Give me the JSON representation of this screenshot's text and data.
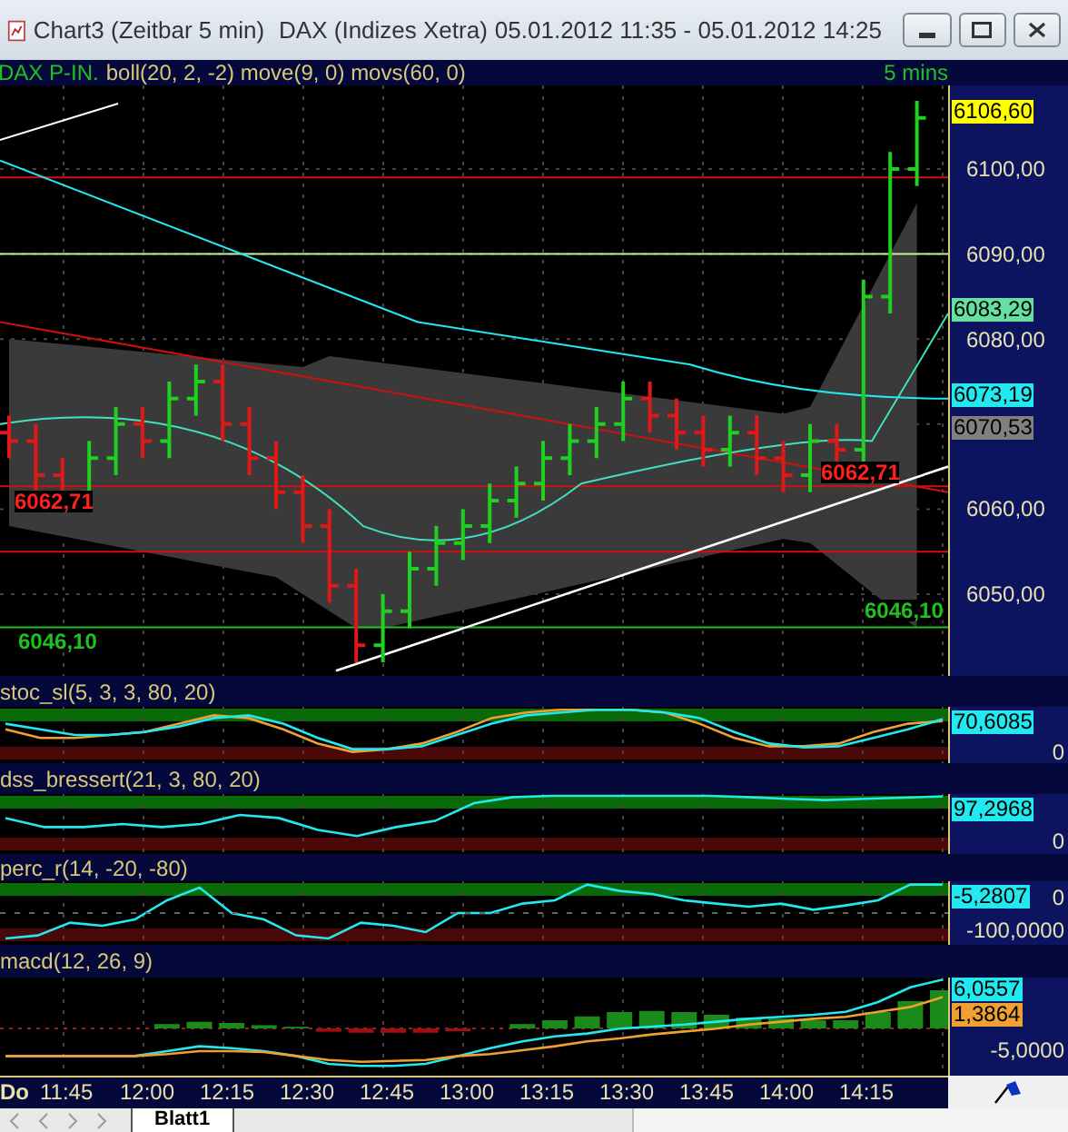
{
  "window": {
    "title": "Chart3 (Zeitbar 5 min)",
    "instrument": "DAX (Indizes Xetra)",
    "range": "05.01.2012 11:35 - 05.01.2012 14:25"
  },
  "header": {
    "symbol": "DAX P-IN.",
    "studies": "boll(20, 2, -2) move(9, 0) movs(60, 0)",
    "interval": "5 mins"
  },
  "price_axis": [
    "6100,00",
    "6090,00",
    "6080,00",
    "6060,00",
    "6050,00"
  ],
  "price_tags": [
    {
      "text": "6106,60",
      "color": "#ffff00"
    },
    {
      "text": "6083,29",
      "color": "#66e0a0"
    },
    {
      "text": "6073,19",
      "color": "#22e8f0"
    },
    {
      "text": "6070,53",
      "color": "#808080"
    }
  ],
  "chart_labels": [
    {
      "text": "6062,71",
      "kind": "resistance"
    },
    {
      "text": "6062,71",
      "kind": "resistance"
    },
    {
      "text": "6046,10",
      "kind": "support"
    },
    {
      "text": "6046,10",
      "kind": "support"
    }
  ],
  "indicators": [
    {
      "kind": "stoch",
      "title": "stoc_sl(5, 3, 3, 80, 20)",
      "tags": [
        {
          "text": "70,6085",
          "color": "#22e8f0"
        }
      ],
      "axis": [
        "0"
      ]
    },
    {
      "kind": "dss",
      "title": "dss_bressert(21, 3, 80, 20)",
      "tags": [
        {
          "text": "97,2968",
          "color": "#22e8f0"
        }
      ],
      "axis": [
        "0"
      ]
    },
    {
      "kind": "percr",
      "title": "perc_r(14, -20, -80)",
      "tags": [
        {
          "text": "-5,2807",
          "color": "#22e8f0"
        }
      ],
      "axis": [
        "0",
        "-100,0000"
      ]
    },
    {
      "kind": "macd",
      "title": "macd(12, 26, 9)",
      "tags": [
        {
          "text": "6,0557",
          "color": "#22e8f0"
        },
        {
          "text": "1,3864",
          "color": "#f0a030"
        }
      ],
      "axis": [
        "-5,0000"
      ]
    }
  ],
  "time_axis": {
    "day": "Do",
    "ticks": [
      "11:45",
      "12:00",
      "12:15",
      "12:30",
      "12:45",
      "13:00",
      "13:15",
      "13:30",
      "13:45",
      "14:00",
      "14:15"
    ]
  },
  "sheet_tabs": [
    {
      "label": "Blatt1",
      "selected": true
    }
  ]
}
